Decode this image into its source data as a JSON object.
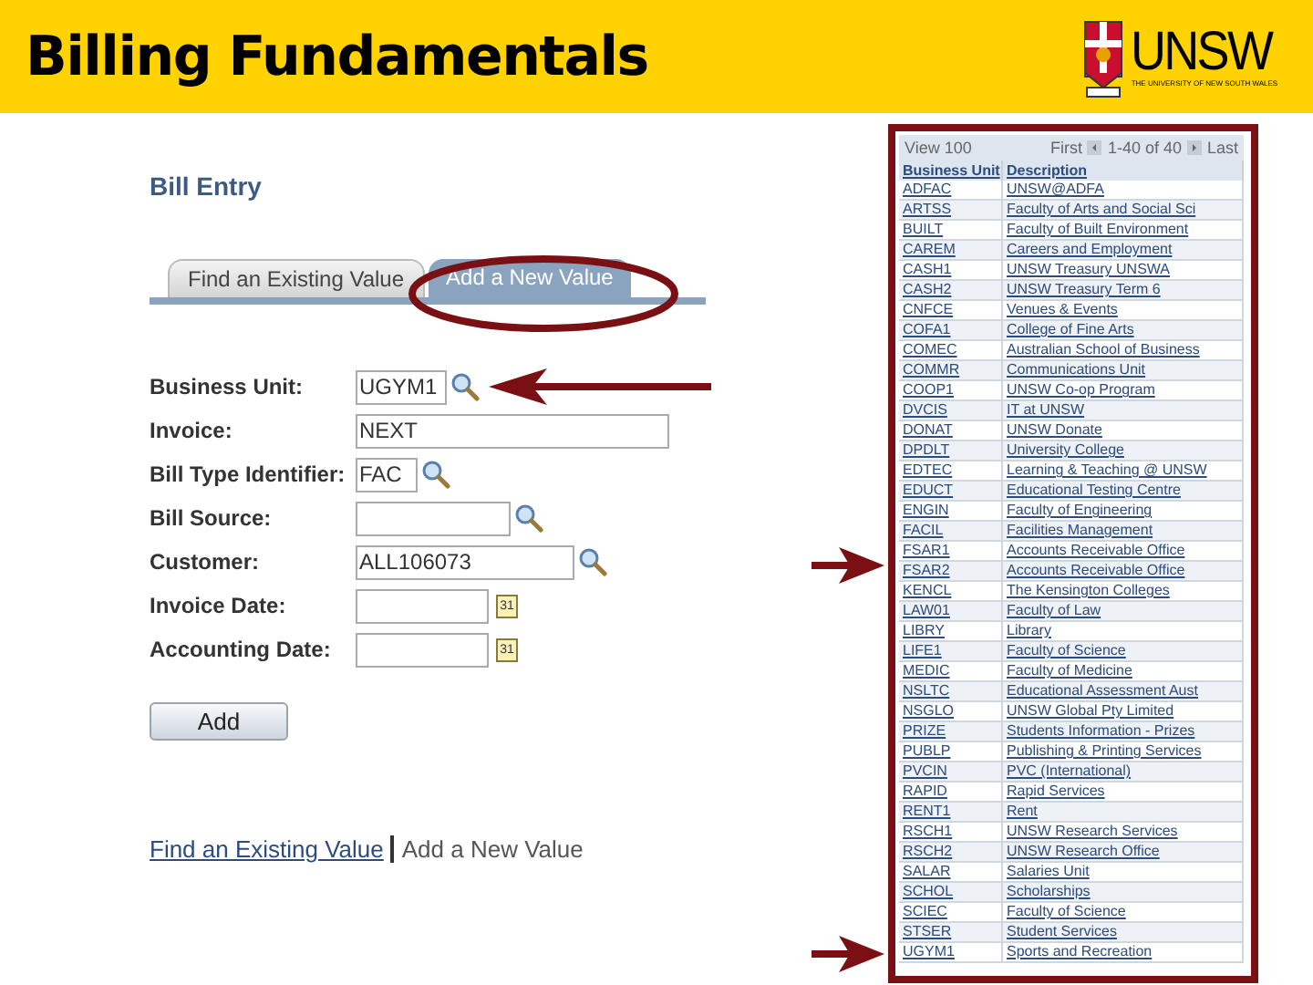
{
  "slide_title": "Billing Fundamentals",
  "logo": {
    "name": "UNSW",
    "subtitle": "THE UNIVERSITY OF NEW SOUTH WALES"
  },
  "page": {
    "title": "Bill Entry",
    "tabs": [
      {
        "label": "Find an Existing Value",
        "selected": false
      },
      {
        "label": "Add a New Value",
        "selected": true
      }
    ],
    "fields": [
      {
        "kind": "lookup",
        "label": "Business Unit:",
        "value": "UGYM1"
      },
      {
        "kind": "text",
        "label": "Invoice:",
        "value": "NEXT"
      },
      {
        "kind": "lookup",
        "label": "Bill Type Identifier:",
        "value": "FAC"
      },
      {
        "kind": "lookup",
        "label": "Bill Source:"
      },
      {
        "kind": "lookup",
        "label": "Customer:",
        "value": "ALL106073"
      },
      {
        "kind": "date",
        "label": "Invoice Date:",
        "icon_text": "31"
      },
      {
        "kind": "date",
        "label": "Accounting Date:",
        "icon_text": "31"
      }
    ],
    "add_button": "Add",
    "footer_links": [
      {
        "label": "Find an Existing Value",
        "selected": false
      },
      {
        "label": "Add a New Value",
        "selected": true
      }
    ]
  },
  "lookup_table": {
    "nav": {
      "view": "View 100",
      "first": "First",
      "range": "1-40 of 40",
      "last": "Last"
    },
    "columns": [
      "Business Unit",
      "Description"
    ],
    "rows": [
      [
        "ADFAC",
        "UNSW@ADFA"
      ],
      [
        "ARTSS",
        "Faculty of Arts and Social Sci"
      ],
      [
        "BUILT",
        "Faculty of Built Environment"
      ],
      [
        "CAREM",
        "Careers and Employment"
      ],
      [
        "CASH1",
        "UNSW Treasury UNSWA"
      ],
      [
        "CASH2",
        "UNSW Treasury Term 6"
      ],
      [
        "CNFCE",
        "Venues & Events"
      ],
      [
        "COFA1",
        "College of Fine Arts"
      ],
      [
        "COMEC",
        "Australian School of Business"
      ],
      [
        "COMMR",
        "Communications Unit"
      ],
      [
        "COOP1",
        "UNSW Co-op Program"
      ],
      [
        "DVCIS",
        "IT at UNSW"
      ],
      [
        "DONAT",
        "UNSW Donate"
      ],
      [
        "DPDLT",
        "University College"
      ],
      [
        "EDTEC",
        "Learning & Teaching @ UNSW"
      ],
      [
        "EDUCT",
        "Educational Testing Centre"
      ],
      [
        "ENGIN",
        "Faculty of Engineering"
      ],
      [
        "FACIL",
        "Facilities Management"
      ],
      [
        "FSAR1",
        "Accounts Receivable Office"
      ],
      [
        "FSAR2",
        "Accounts Receivable Office"
      ],
      [
        "KENCL",
        "The Kensington Colleges"
      ],
      [
        "LAW01",
        "Faculty of Law"
      ],
      [
        "LIBRY",
        "Library"
      ],
      [
        "LIFE1",
        "Faculty of Science"
      ],
      [
        "MEDIC",
        "Faculty of Medicine"
      ],
      [
        "NSLTC",
        "Educational Assessment Aust"
      ],
      [
        "NSGLO",
        "UNSW Global Pty Limited"
      ],
      [
        "PRIZE",
        "Students Information - Prizes"
      ],
      [
        "PUBLP",
        "Publishing & Printing Services"
      ],
      [
        "PVCIN",
        "PVC (International)"
      ],
      [
        "RAPID",
        "Rapid Services"
      ],
      [
        "RENT1",
        "Rent"
      ],
      [
        "RSCH1",
        "UNSW Research Services"
      ],
      [
        "RSCH2",
        "UNSW Research Office"
      ],
      [
        "SALAR",
        "Salaries Unit"
      ],
      [
        "SCHOL",
        "Scholarships"
      ],
      [
        "SCIEC",
        "Faculty of Science"
      ],
      [
        "STSER",
        "Student Services"
      ],
      [
        "UGYM1",
        "Sports and Recreation"
      ]
    ]
  }
}
